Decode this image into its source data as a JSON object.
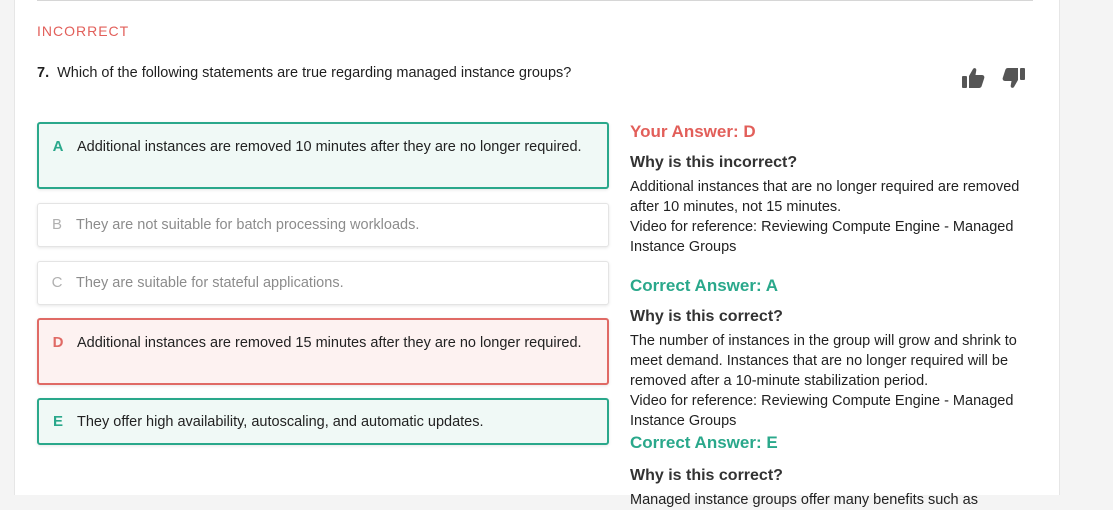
{
  "result": {
    "status": "INCORRECT"
  },
  "question": {
    "number": "7.",
    "text": "Which of the following statements are true regarding managed instance groups?"
  },
  "feedback": {
    "thumbs_up_icon": "thumbs-up-icon",
    "thumbs_down_icon": "thumbs-down-icon"
  },
  "options": [
    {
      "letter": "A",
      "text": "Additional instances are removed 10 minutes after they are no longer required.",
      "state": "correct"
    },
    {
      "letter": "B",
      "text": "They are not suitable for batch processing workloads.",
      "state": "neutral"
    },
    {
      "letter": "C",
      "text": "They are suitable for stateful applications.",
      "state": "neutral"
    },
    {
      "letter": "D",
      "text": "Additional instances are removed 15 minutes after they are no longer required.",
      "state": "wrong"
    },
    {
      "letter": "E",
      "text": "They offer high availability, autoscaling, and automatic updates.",
      "state": "correct"
    }
  ],
  "explanations": {
    "your_answer": {
      "heading": "Your Answer: D",
      "why": "Why is this incorrect?",
      "body": "Additional instances that are no longer required are removed after 10 minutes, not 15 minutes.",
      "reference": "Video for reference: Reviewing Compute Engine - Managed Instance Groups"
    },
    "correct_a": {
      "heading": "Correct Answer: A",
      "why": "Why is this correct?",
      "body": "The number of instances in the group will grow and shrink to meet demand. Instances that are no longer required will be removed after a 10-minute stabilization period.",
      "reference": "Video for reference: Reviewing Compute Engine - Managed Instance Groups"
    },
    "correct_e": {
      "heading": "Correct Answer: E",
      "why": "Why is this correct?",
      "body": "Managed instance groups offer many benefits such as"
    }
  },
  "colors": {
    "correct": "#2aa88b",
    "wrong": "#e25f5a",
    "neutral_text": "#8c8c8c"
  }
}
